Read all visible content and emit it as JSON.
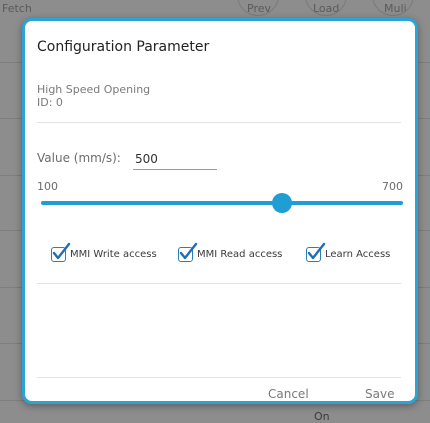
{
  "background": {
    "top_label": "Fetch",
    "top_col2": "Prev",
    "top_col3": "Load",
    "top_col4": "Muli",
    "bottom_label": "On"
  },
  "dialog": {
    "title": "Configuration Parameter",
    "parameter_name": "High Speed Opening",
    "parameter_id": "ID: 0",
    "value_label": "Value (mm/s):",
    "value": "500",
    "range_min": "100",
    "range_max": "700",
    "slider_value": 500,
    "slider_min": 100,
    "slider_max": 700,
    "checkboxes": [
      {
        "label": "MMI Write access",
        "checked": true
      },
      {
        "label": "MMI Read access",
        "checked": true
      },
      {
        "label": "Learn Access",
        "checked": true
      }
    ],
    "cancel_label": "Cancel",
    "save_label": "Save"
  },
  "colors": {
    "accent": "#1f9ed4",
    "dialog_border": "#2aa3d6",
    "checkbox_border": "#2c7fb8"
  }
}
